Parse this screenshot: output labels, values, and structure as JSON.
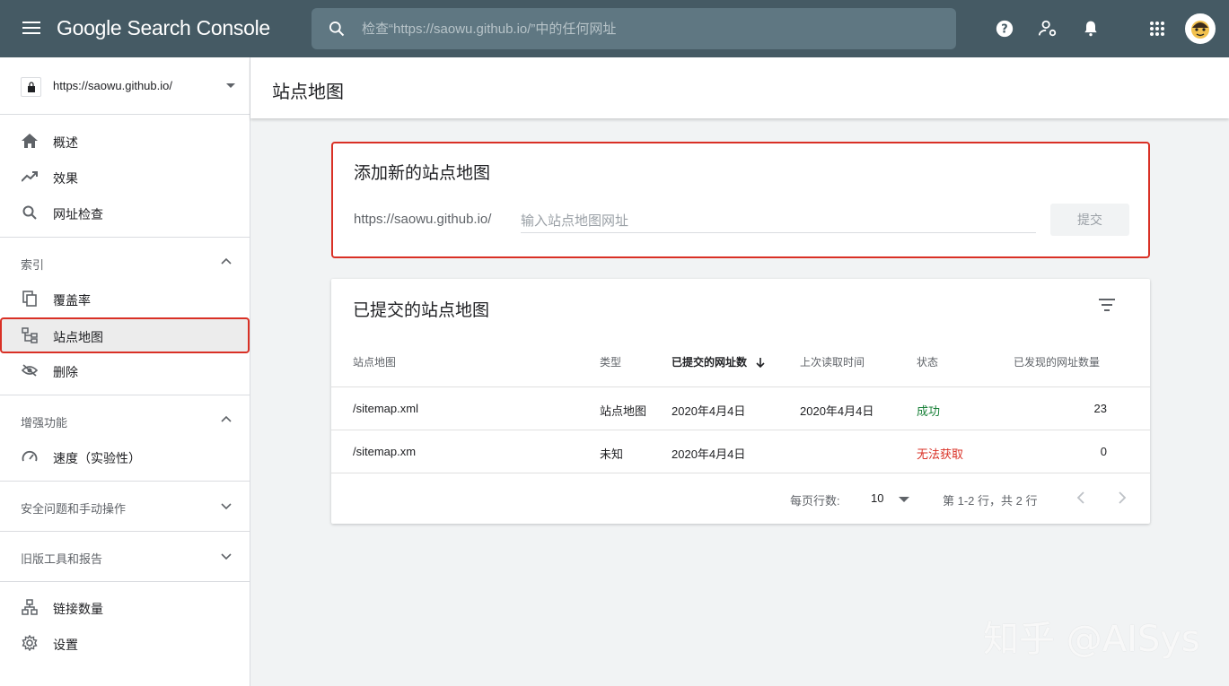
{
  "app": {
    "title": "Google Search Console"
  },
  "search": {
    "placeholder": "检查“https://saowu.github.io/”中的任何网址"
  },
  "property": {
    "url": "https://saowu.github.io/"
  },
  "sidebar": {
    "items_top": [
      {
        "label": "概述",
        "icon": "home-icon"
      },
      {
        "label": "效果",
        "icon": "trending-up-icon"
      },
      {
        "label": "网址检查",
        "icon": "search-icon"
      }
    ],
    "section_index": {
      "label": "索引"
    },
    "items_index": [
      {
        "label": "覆盖率",
        "icon": "copy-icon"
      },
      {
        "label": "站点地图",
        "icon": "sitemap-icon"
      },
      {
        "label": "删除",
        "icon": "visibility-off-icon"
      }
    ],
    "section_enhance": {
      "label": "增强功能"
    },
    "items_enhance": [
      {
        "label": "速度（实验性）",
        "icon": "speed-icon"
      }
    ],
    "section_security": {
      "label": "安全问题和手动操作"
    },
    "section_legacy": {
      "label": "旧版工具和报告"
    },
    "items_bottom": [
      {
        "label": "链接数量",
        "icon": "links-icon"
      },
      {
        "label": "设置",
        "icon": "gear-icon"
      }
    ]
  },
  "page": {
    "title": "站点地图"
  },
  "add_card": {
    "title": "添加新的站点地图",
    "prefix": "https://saowu.github.io/",
    "input_placeholder": "输入站点地图网址",
    "input_value": "",
    "submit_label": "提交"
  },
  "list_card": {
    "title": "已提交的站点地图",
    "columns": [
      "站点地图",
      "类型",
      "已提交的网址数",
      "上次读取时间",
      "状态",
      "已发现的网址数量"
    ],
    "rows": [
      {
        "sitemap": "/sitemap.xml",
        "type": "站点地图",
        "submitted": "2020年4月4日",
        "last_read": "2020年4月4日",
        "status": "成功",
        "discovered": "23"
      },
      {
        "sitemap": "/sitemap.xm",
        "type": "未知",
        "submitted": "2020年4月4日",
        "last_read": "",
        "status": "无法获取",
        "discovered": "0"
      }
    ],
    "pager": {
      "rows_per_page_label": "每页行数:",
      "rows_per_page": "10",
      "range": "第 1-2 行，共 2 行"
    }
  },
  "colors": {
    "topbar": "#455a64",
    "accent_red": "#d93025",
    "success": "#188038"
  },
  "watermark": "知乎 @AISys"
}
